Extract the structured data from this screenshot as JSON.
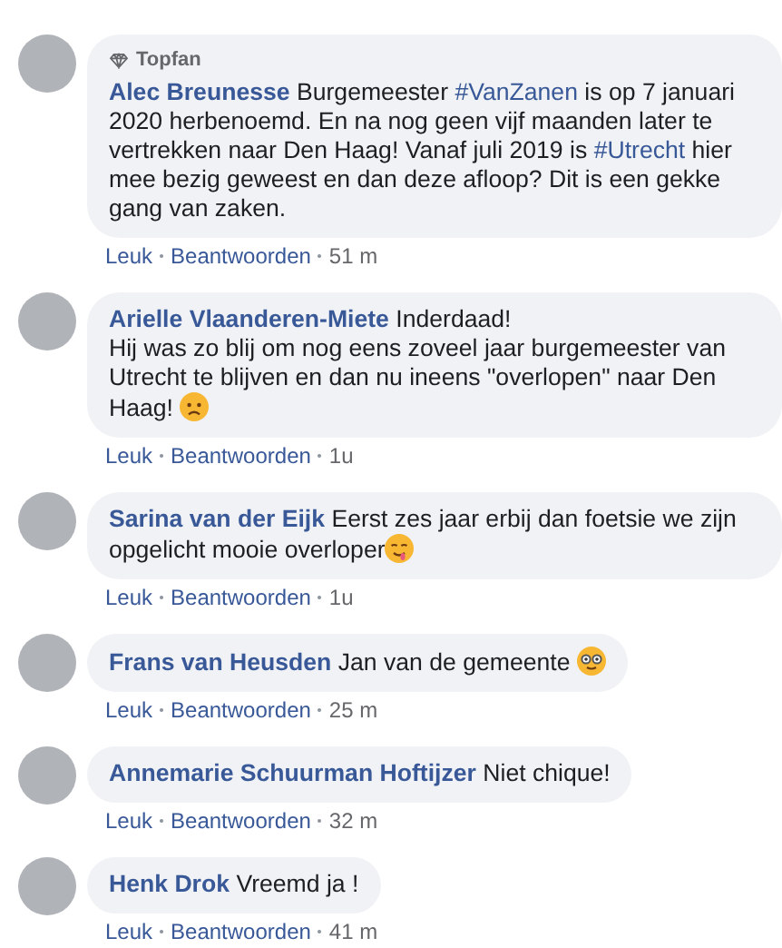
{
  "comments": [
    {
      "author": "Alec Breunesse",
      "badge": "Topfan",
      "body": [
        {
          "kind": "text",
          "text": "Burgemeester "
        },
        {
          "kind": "hashtag",
          "text": "#VanZanen"
        },
        {
          "kind": "text",
          "text": " is op 7 januari 2020 herbenoemd. En na nog geen vijf maanden later te vertrekken naar Den Haag! Vanaf juli 2019 is "
        },
        {
          "kind": "hashtag",
          "text": "#Utrecht"
        },
        {
          "kind": "text",
          "text": " hier mee bezig geweest en dan deze afloop? Dit is een gekke gang van zaken."
        }
      ],
      "like": "Leuk",
      "reply": "Beantwoorden",
      "time": "51 m"
    },
    {
      "author": "Arielle Vlaanderen-Miete",
      "body": [
        {
          "kind": "text",
          "text": "Inderdaad!\nHij was zo blij om nog eens zoveel jaar burgemeester van Utrecht te blijven en dan nu ineens \"overlopen\" naar Den Haag! "
        },
        {
          "kind": "frown"
        }
      ],
      "like": "Leuk",
      "reply": "Beantwoorden",
      "time": "1u"
    },
    {
      "author": "Sarina van der Eijk",
      "body": [
        {
          "kind": "text",
          "text": "Eerst zes jaar erbij dan foetsie we zijn opgelicht mooie overloper"
        },
        {
          "kind": "drool"
        }
      ],
      "like": "Leuk",
      "reply": "Beantwoorden",
      "time": "1u"
    },
    {
      "author": "Frans van Heusden",
      "body": [
        {
          "kind": "text",
          "text": "Jan van de gemeente "
        },
        {
          "kind": "glasses"
        }
      ],
      "like": "Leuk",
      "reply": "Beantwoorden",
      "time": "25 m"
    },
    {
      "author": "Annemarie Schuurman Hoftijzer",
      "body": [
        {
          "kind": "text",
          "text": "Niet chique!"
        }
      ],
      "like": "Leuk",
      "reply": "Beantwoorden",
      "time": "32 m"
    },
    {
      "author": "Henk Drok",
      "body": [
        {
          "kind": "text",
          "text": "Vreemd ja !"
        }
      ],
      "like": "Leuk",
      "reply": "Beantwoorden",
      "time": "41 m"
    }
  ]
}
